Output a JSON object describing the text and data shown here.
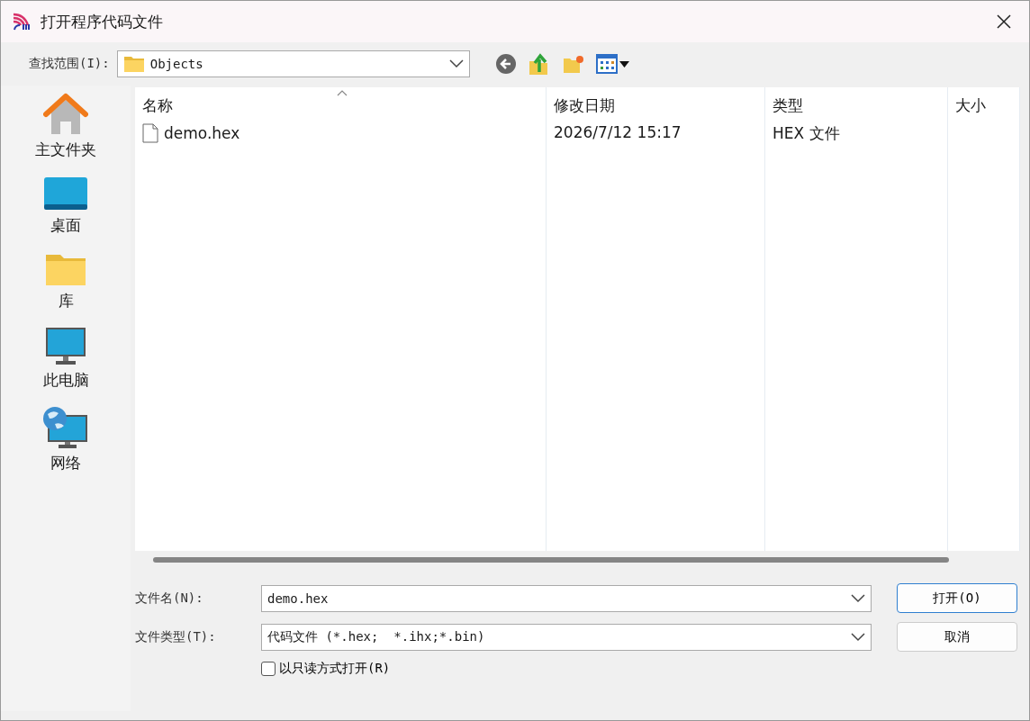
{
  "window": {
    "title": "打开程序代码文件"
  },
  "look_in": {
    "label": "查找范围(I):",
    "value": "Objects"
  },
  "sidebar": {
    "items": [
      {
        "kind": "home",
        "label": "主文件夹"
      },
      {
        "kind": "desktop",
        "label": "桌面"
      },
      {
        "kind": "library",
        "label": "库"
      },
      {
        "kind": "computer",
        "label": "此电脑"
      },
      {
        "kind": "network",
        "label": "网络"
      }
    ]
  },
  "table": {
    "columns": [
      {
        "label": "名称",
        "sorted": true
      },
      {
        "label": "修改日期",
        "sorted": false
      },
      {
        "label": "类型",
        "sorted": false
      },
      {
        "label": "大小",
        "sorted": false
      }
    ],
    "rows": [
      {
        "cells": [
          "demo.hex",
          "2026/7/12 15:17",
          "HEX 文件"
        ]
      }
    ]
  },
  "file_name": {
    "label": "文件名(N):",
    "value": "demo.hex"
  },
  "file_type": {
    "label": "文件类型(T):",
    "value": "代码文件 (*.hex;  *.ihx;*.bin)"
  },
  "read_only": {
    "label": "以只读方式打开(R)",
    "checked": false
  },
  "buttons": [
    {
      "label": "打开(O)",
      "default": true
    },
    {
      "label": "取消",
      "default": false
    }
  ]
}
